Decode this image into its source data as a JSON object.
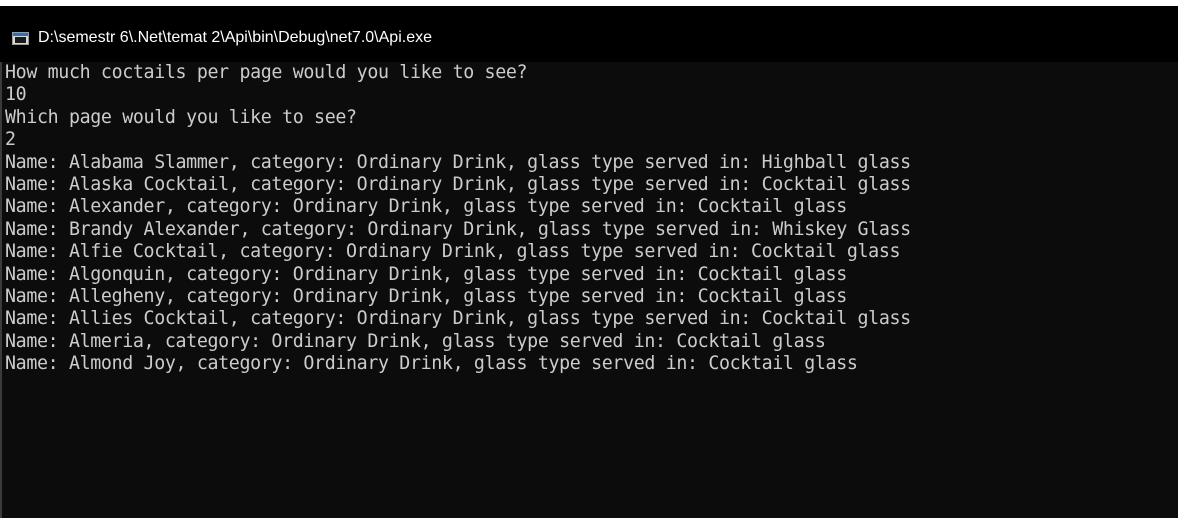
{
  "window": {
    "title": "D:\\semestr 6\\.Net\\temat 2\\Api\\bin\\Debug\\net7.0\\Api.exe"
  },
  "console": {
    "lines": [
      "How much coctails per page would you like to see?",
      "10",
      "Which page would you like to see?",
      "2",
      "Name: Alabama Slammer, category: Ordinary Drink, glass type served in: Highball glass",
      "Name: Alaska Cocktail, category: Ordinary Drink, glass type served in: Cocktail glass",
      "Name: Alexander, category: Ordinary Drink, glass type served in: Cocktail glass",
      "Name: Brandy Alexander, category: Ordinary Drink, glass type served in: Whiskey Glass",
      "Name: Alfie Cocktail, category: Ordinary Drink, glass type served in: Cocktail glass",
      "Name: Algonquin, category: Ordinary Drink, glass type served in: Cocktail glass",
      "Name: Allegheny, category: Ordinary Drink, glass type served in: Cocktail glass",
      "Name: Allies Cocktail, category: Ordinary Drink, glass type served in: Cocktail glass",
      "Name: Almeria, category: Ordinary Drink, glass type served in: Cocktail glass",
      "Name: Almond Joy, category: Ordinary Drink, glass type served in: Cocktail glass"
    ]
  },
  "colors": {
    "console_background": "#0c0c0c",
    "console_text": "#cccccc",
    "titlebar_background": "#000000",
    "titlebar_text": "#ffffff"
  },
  "icons": {
    "app_icon": "console-window-icon"
  }
}
